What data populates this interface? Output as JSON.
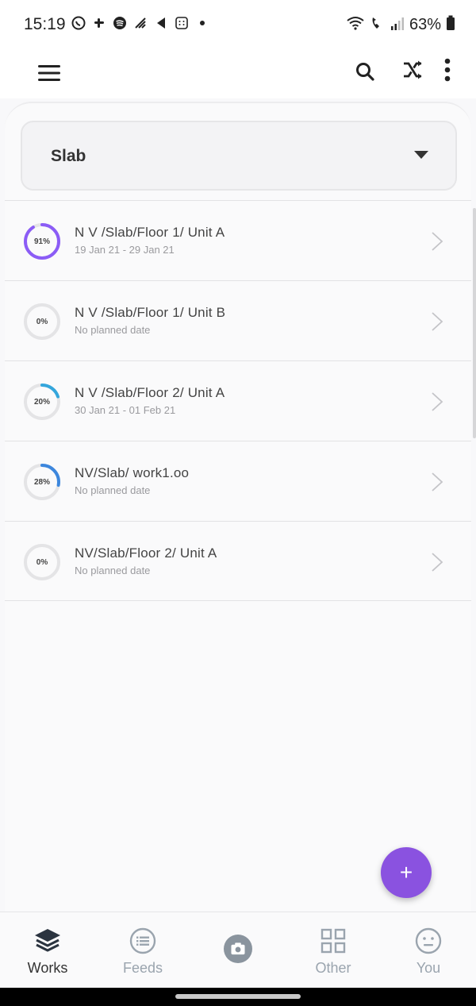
{
  "status_bar": {
    "time": "15:19",
    "battery": "63%"
  },
  "dropdown": {
    "selected": "Slab"
  },
  "works": [
    {
      "title": "N V /Slab/Floor 1/ Unit A",
      "subtitle": "19 Jan 21 - 29 Jan 21",
      "progress_label": "91%",
      "progress": 0.91,
      "color": "#8b5cf6"
    },
    {
      "title": "N V /Slab/Floor 1/ Unit B",
      "subtitle": "No planned date",
      "progress_label": "0%",
      "progress": 0.0,
      "color": "#3a9be0"
    },
    {
      "title": "N V /Slab/Floor 2/ Unit A",
      "subtitle": "30 Jan 21 - 01 Feb 21",
      "progress_label": "20%",
      "progress": 0.2,
      "color": "#34a6dc"
    },
    {
      "title": "NV/Slab/ work1.oo",
      "subtitle": "No planned date",
      "progress_label": "28%",
      "progress": 0.28,
      "color": "#3d87dd"
    },
    {
      "title": "NV/Slab/Floor 2/ Unit A",
      "subtitle": "No planned date",
      "progress_label": "0%",
      "progress": 0.0,
      "color": "#3a9be0"
    }
  ],
  "fab": {
    "label": "+"
  },
  "bottom_nav": [
    {
      "label": "Works",
      "icon": "layers-icon",
      "active": true
    },
    {
      "label": "Feeds",
      "icon": "list-circle-icon",
      "active": false
    },
    {
      "label": "",
      "icon": "camera-icon",
      "active": false
    },
    {
      "label": "Other",
      "icon": "grid-icon",
      "active": false
    },
    {
      "label": "You",
      "icon": "face-icon",
      "active": false
    }
  ],
  "colors": {
    "accent": "#8a52e0",
    "track": "#e4e4e6",
    "nav_inactive": "#9aa4ae"
  }
}
